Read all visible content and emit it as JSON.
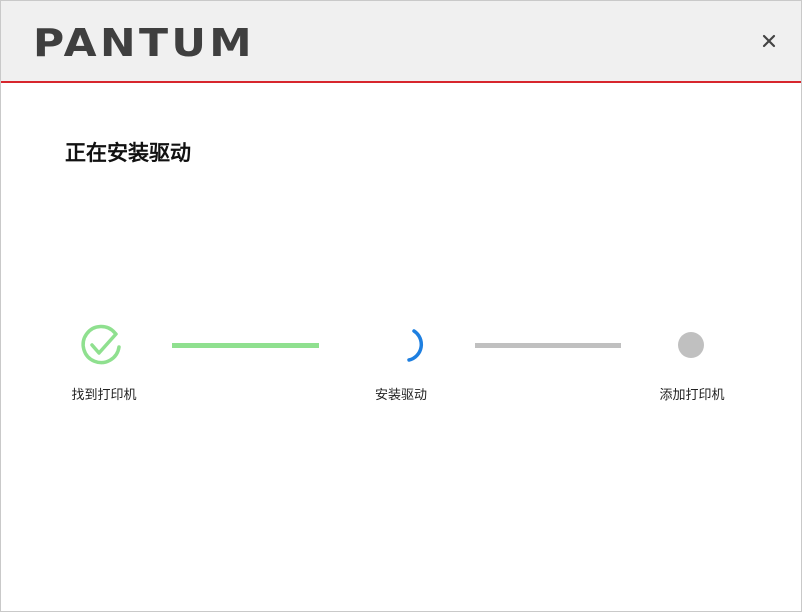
{
  "window": {
    "brand": "PANTUM",
    "close_symbol": "×"
  },
  "main": {
    "heading": "正在安装驱动"
  },
  "progress": {
    "steps": [
      {
        "label": "找到打印机",
        "state": "completed",
        "icon": "check-circle-icon"
      },
      {
        "label": "安装驱动",
        "state": "in-progress",
        "icon": "spinner-icon"
      },
      {
        "label": "添加打印机",
        "state": "pending",
        "icon": "pending-dot-icon"
      }
    ],
    "connectors": [
      {
        "state": "completed"
      },
      {
        "state": "pending"
      }
    ]
  },
  "colors": {
    "accent_red": "#d7262d",
    "success_green": "#8fe08f",
    "spinner_blue": "#1e7fe0",
    "pending_gray": "#c0c0c0",
    "titlebar_bg": "#f0f0f0",
    "logo_dark": "#3f3f3f"
  }
}
